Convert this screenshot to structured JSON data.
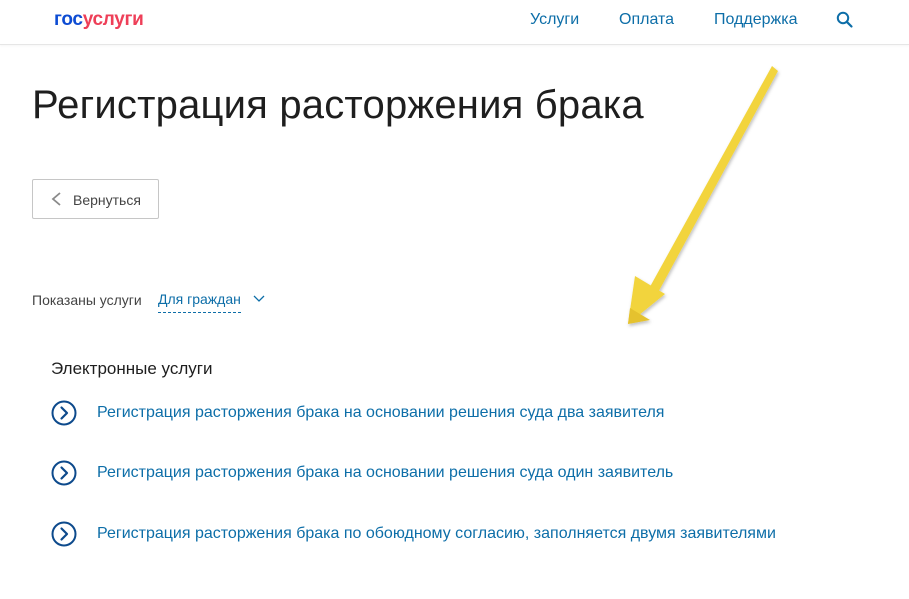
{
  "header": {
    "logo": {
      "part1": "гос",
      "part2": "услуги"
    },
    "nav": [
      {
        "label": "Услуги"
      },
      {
        "label": "Оплата"
      },
      {
        "label": "Поддержка"
      }
    ],
    "search_icon": "search-icon"
  },
  "main": {
    "title": "Регистрация расторжения брака",
    "back_button": {
      "label": "Вернуться",
      "icon": "chevron-left-icon"
    },
    "filter": {
      "label": "Показаны услуги",
      "selected": "Для граждан",
      "icon": "chevron-down-icon"
    },
    "section": {
      "title": "Электронные услуги",
      "items": [
        {
          "label": "Регистрация расторжения брака на основании решения суда два заявителя",
          "icon": "circle-chevron-right-icon"
        },
        {
          "label": "Регистрация расторжения брака на основании решения суда один заявитель",
          "icon": "circle-chevron-right-icon"
        },
        {
          "label": "Регистрация расторжения брака по обоюдному согласию, заполняется двумя заявителями",
          "icon": "circle-chevron-right-icon"
        }
      ]
    }
  },
  "colors": {
    "brand_blue": "#0d4cd3",
    "brand_red": "#ee3f58",
    "link": "#0d6ea8",
    "annotation_arrow": "#f2d43c"
  }
}
